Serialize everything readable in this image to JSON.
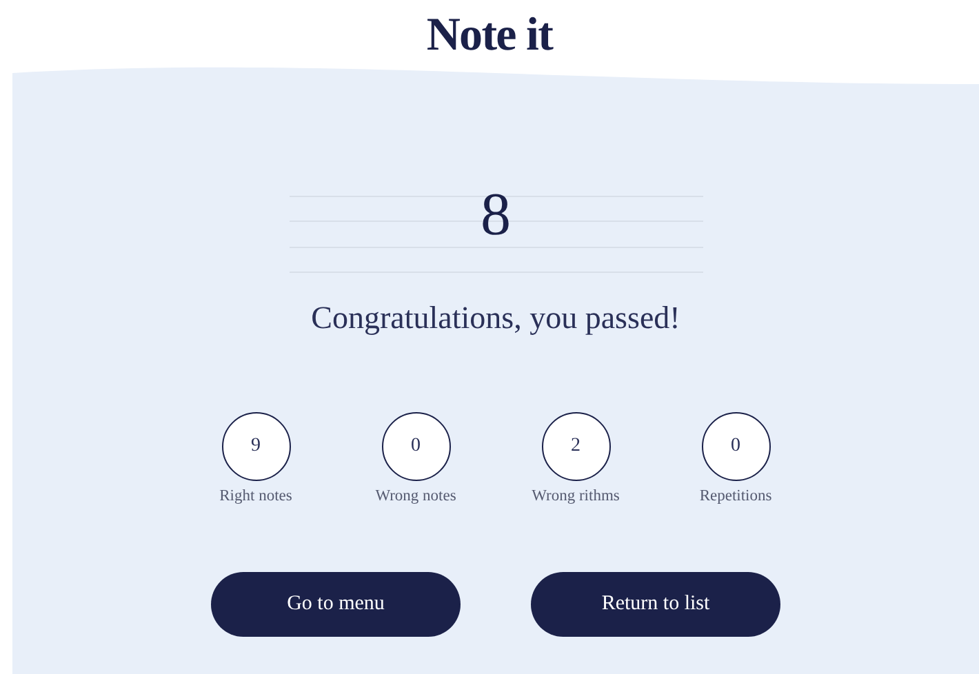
{
  "app_title": "Note it",
  "score": "8",
  "message": "Congratulations, you passed!",
  "stats": [
    {
      "value": "9",
      "label": "Right notes"
    },
    {
      "value": "0",
      "label": "Wrong notes"
    },
    {
      "value": "2",
      "label": "Wrong rithms"
    },
    {
      "value": "0",
      "label": "Repetitions"
    }
  ],
  "buttons": [
    "Go to menu",
    "Return to list"
  ]
}
